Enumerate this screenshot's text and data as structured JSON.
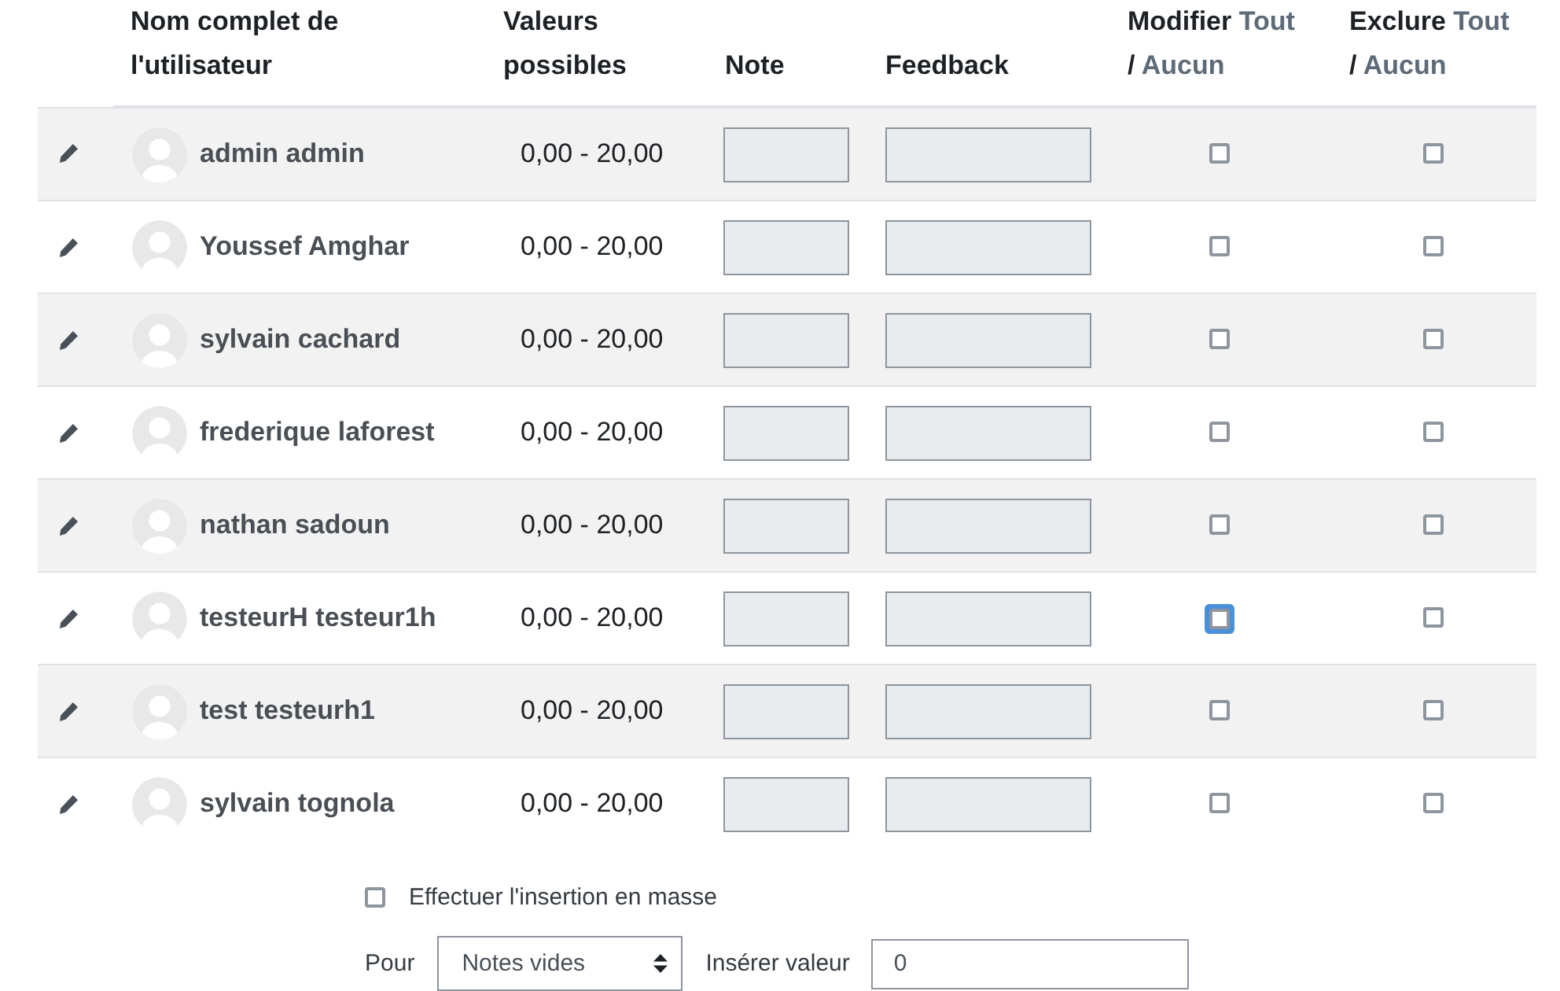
{
  "table": {
    "columns": [
      {
        "kind": "text",
        "label": "Nom complet de l'utilisateur"
      },
      {
        "kind": "text",
        "label": "Valeurs possibles"
      },
      {
        "kind": "text",
        "label": "Note"
      },
      {
        "kind": "text",
        "label": "Feedback"
      },
      {
        "kind": "toggle",
        "label": "Modifier",
        "all": "Tout",
        "separator": "/",
        "none": "Aucun"
      },
      {
        "kind": "toggle",
        "label": "Exclure",
        "all": "Tout",
        "separator": "/",
        "none": "Aucun"
      }
    ],
    "rows": [
      {
        "name": "admin admin",
        "range": "0,00 - 20,00",
        "modify": {
          "checked": false,
          "focused": false
        },
        "exclude": {
          "checked": false,
          "focused": false
        }
      },
      {
        "name": "Youssef Amghar",
        "range": "0,00 - 20,00",
        "modify": {
          "checked": false,
          "focused": false
        },
        "exclude": {
          "checked": false,
          "focused": false
        }
      },
      {
        "name": "sylvain cachard",
        "range": "0,00 - 20,00",
        "modify": {
          "checked": false,
          "focused": false
        },
        "exclude": {
          "checked": false,
          "focused": false
        }
      },
      {
        "name": "frederique laforest",
        "range": "0,00 - 20,00",
        "modify": {
          "checked": false,
          "focused": false
        },
        "exclude": {
          "checked": false,
          "focused": false
        }
      },
      {
        "name": "nathan sadoun",
        "range": "0,00 - 20,00",
        "modify": {
          "checked": false,
          "focused": false
        },
        "exclude": {
          "checked": false,
          "focused": false
        }
      },
      {
        "name": "testeurH testeur1h",
        "range": "0,00 - 20,00",
        "modify": {
          "checked": false,
          "focused": true
        },
        "exclude": {
          "checked": false,
          "focused": false
        }
      },
      {
        "name": "test testeurh1",
        "range": "0,00 - 20,00",
        "modify": {
          "checked": false,
          "focused": false
        },
        "exclude": {
          "checked": false,
          "focused": false
        }
      },
      {
        "name": "sylvain tognola",
        "range": "0,00 - 20,00",
        "modify": {
          "checked": false,
          "focused": false
        },
        "exclude": {
          "checked": false,
          "focused": false
        }
      }
    ]
  },
  "bulk_insert": {
    "checked": false,
    "label": "Effectuer l'insertion en masse",
    "for_label": "Pour",
    "select_value": "Notes vides",
    "value_label": "Insérer valeur",
    "value": "0"
  }
}
